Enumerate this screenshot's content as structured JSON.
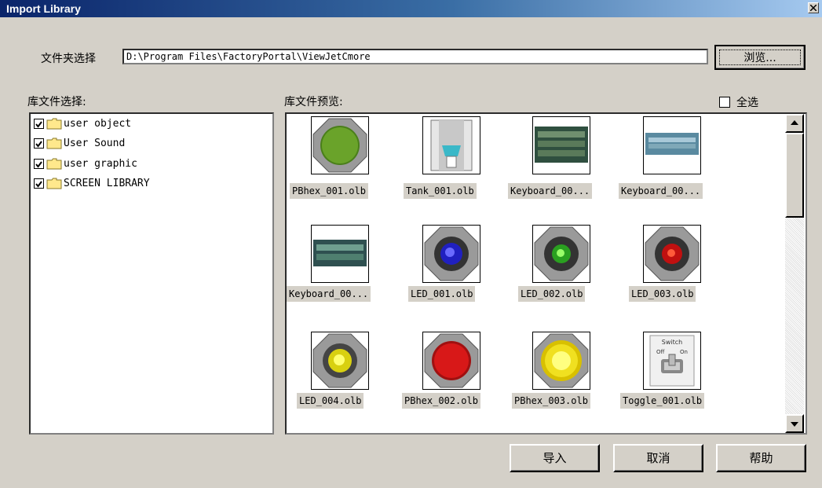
{
  "window": {
    "title": "Import Library"
  },
  "folder": {
    "label": "文件夹选择",
    "path": "D:\\Program Files\\FactoryPortal\\ViewJetCmore",
    "browse_label": "浏览..."
  },
  "tree": {
    "heading": "库文件选择:",
    "items": [
      {
        "label": "user object",
        "checked": true
      },
      {
        "label": "User Sound",
        "checked": true
      },
      {
        "label": "user graphic",
        "checked": true
      },
      {
        "label": "SCREEN LIBRARY",
        "checked": true
      }
    ]
  },
  "preview": {
    "heading": "库文件预览:",
    "select_all": "全选",
    "items": [
      {
        "name": "PBhex_001.olb",
        "icon": "pushbutton-hex-green-icon"
      },
      {
        "name": "Tank_001.olb",
        "icon": "tank-icon"
      },
      {
        "name": "Keyboard_00...",
        "icon": "keyboard-icon"
      },
      {
        "name": "Keyboard_00...",
        "icon": "keyboard-icon"
      },
      {
        "name": "Keyboard_00...",
        "icon": "keyboard-icon"
      },
      {
        "name": "LED_001.olb",
        "icon": "led-blue-icon"
      },
      {
        "name": "LED_002.olb",
        "icon": "led-green-icon"
      },
      {
        "name": "LED_003.olb",
        "icon": "led-red-icon"
      },
      {
        "name": "LED_004.olb",
        "icon": "led-yellow-icon"
      },
      {
        "name": "PBhex_002.olb",
        "icon": "pushbutton-hex-red-icon"
      },
      {
        "name": "PBhex_003.olb",
        "icon": "pushbutton-hex-yellow-icon"
      },
      {
        "name": "Toggle_001.olb",
        "icon": "toggle-switch-icon"
      }
    ],
    "toggle_text": [
      "Switch",
      "Off",
      "On"
    ]
  },
  "buttons": {
    "import": "导入",
    "cancel": "取消",
    "help": "帮助"
  }
}
